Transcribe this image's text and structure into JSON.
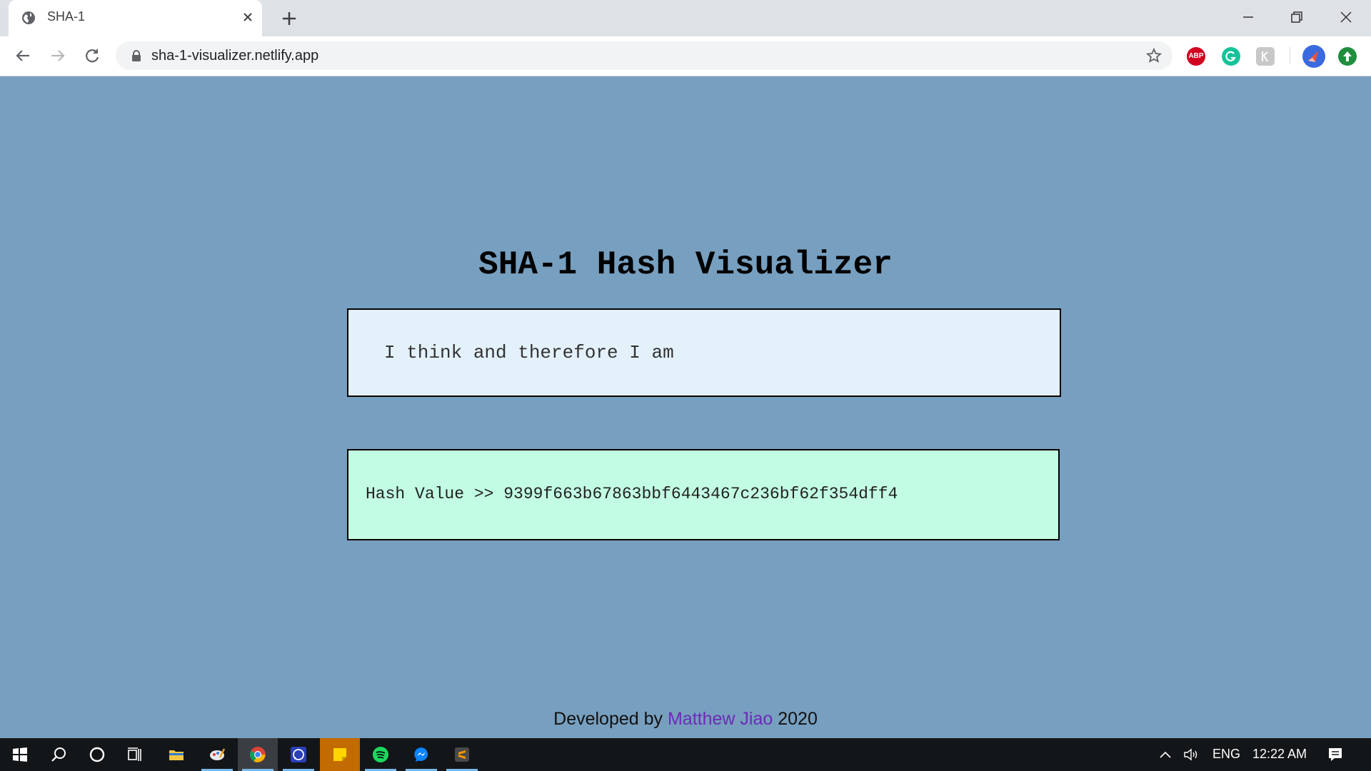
{
  "browser": {
    "tab_title": "SHA-1",
    "url": "sha-1-visualizer.netlify.app",
    "extensions": {
      "abp_label": "ABP"
    }
  },
  "page": {
    "title": "SHA-1 Hash Visualizer",
    "input_value": "I think and therefore I am",
    "hash_label": "Hash Value >>",
    "hash_value": "9399f663b67863bbf6443467c236bf62f354dff4",
    "footer": {
      "prefix": "Developed by",
      "author": "Matthew Jiao",
      "year": "2020"
    }
  },
  "taskbar": {
    "apps": [
      "start",
      "search",
      "cortana",
      "task-view",
      "file-explorer",
      "paint",
      "chrome",
      "whatsapp",
      "sticky-notes",
      "spotify",
      "messenger",
      "sublime-text"
    ],
    "language": "ENG",
    "time": "12:22 AM"
  }
}
